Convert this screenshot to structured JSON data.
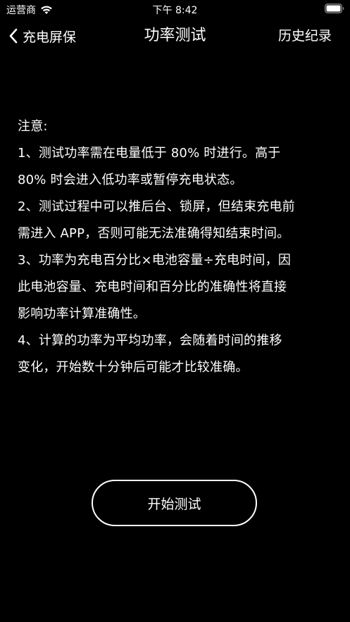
{
  "status_bar": {
    "carrier": "运营商",
    "time": "下午 8:42"
  },
  "nav": {
    "back_label": "充电屏保",
    "title": "功率测试",
    "history_label": "历史纪录"
  },
  "notes": {
    "heading": "注意:",
    "lines": [
      "1、测试功率需在电量低于 80% 时进行。高于",
      "80% 时会进入低功率或暂停充电状态。",
      "2、测试过程中可以推后台、锁屏，但结束充电前",
      "需进入 APP，否则可能无法准确得知结束时间。",
      "3、功率为充电百分比×电池容量÷充电时间，因",
      "此电池容量、充电时间和百分比的准确性将直接",
      "影响功率计算准确性。",
      "4、计算的功率为平均功率，会随着时间的推移",
      "变化，开始数十分钟后可能才比较准确。"
    ]
  },
  "start_button": {
    "label": "开始测试"
  },
  "colors": {
    "background": "#000000",
    "foreground": "#ffffff"
  },
  "icons": {
    "wifi": "wifi-icon",
    "battery": "battery-icon",
    "back": "chevron-left-icon"
  }
}
